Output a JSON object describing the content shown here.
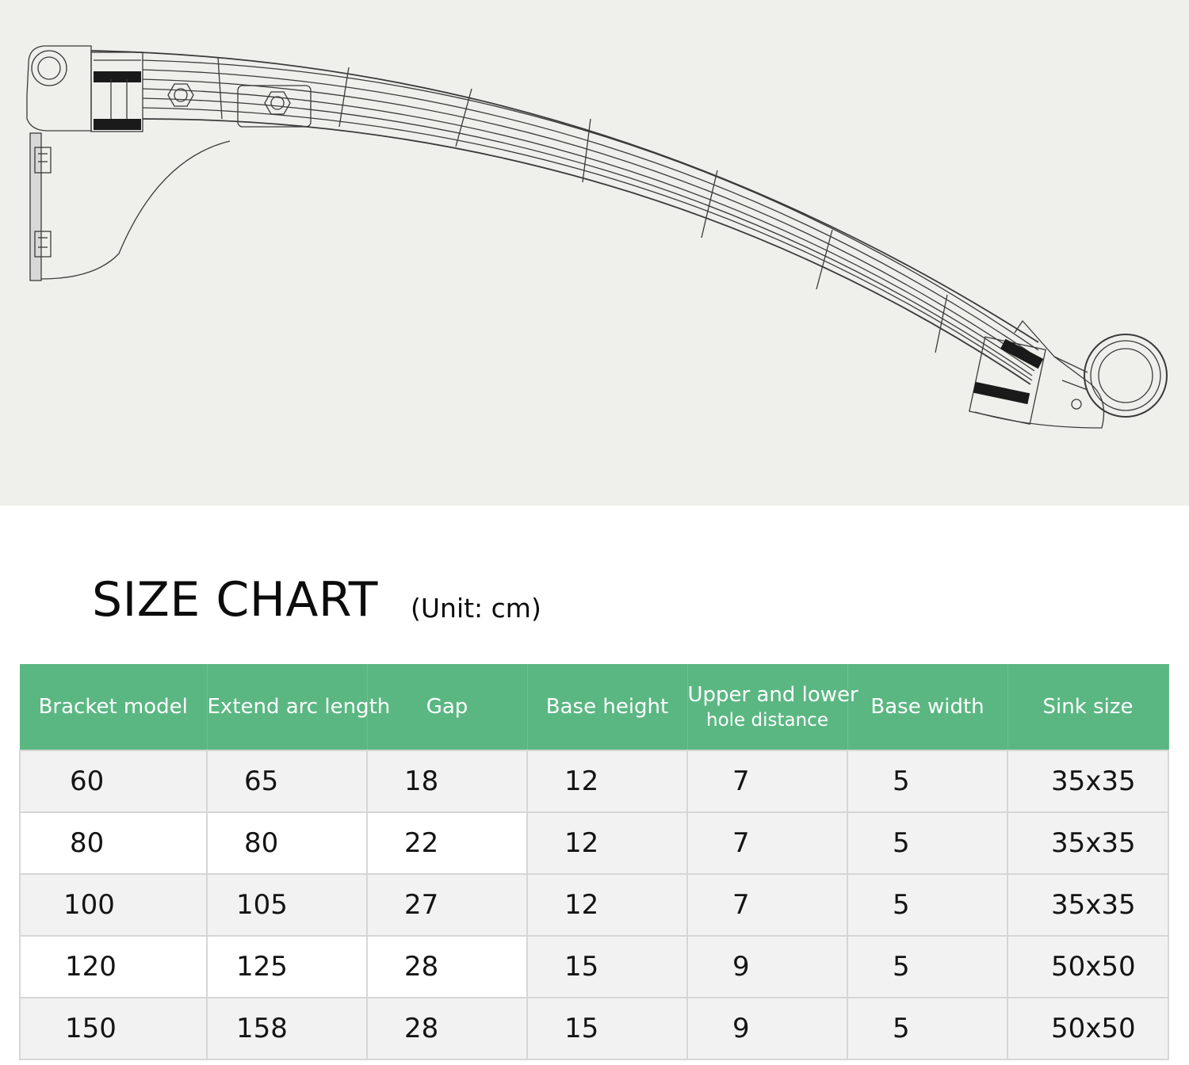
{
  "drawing": {
    "icon": "bracket-technical-drawing"
  },
  "title": "SIZE CHART",
  "unit": "(Unit: cm)",
  "table": {
    "headers": [
      {
        "line1": "Bracket model",
        "line2": ""
      },
      {
        "line1": "Extend arc length",
        "line2": ""
      },
      {
        "line1": "Gap",
        "line2": ""
      },
      {
        "line1": "Base height",
        "line2": ""
      },
      {
        "line1": "Upper and lower",
        "line2": "hole distance"
      },
      {
        "line1": "Base width",
        "line2": ""
      },
      {
        "line1": "Sink size",
        "line2": ""
      }
    ],
    "rows": [
      [
        "60",
        "65",
        "18",
        "12",
        "7",
        "5",
        "35x35"
      ],
      [
        "80",
        "80",
        "22",
        "12",
        "7",
        "5",
        "35x35"
      ],
      [
        "100",
        "105",
        "27",
        "12",
        "7",
        "5",
        "35x35"
      ],
      [
        "120",
        "125",
        "28",
        "15",
        "9",
        "5",
        "50x50"
      ],
      [
        "150",
        "158",
        "28",
        "15",
        "9",
        "5",
        "50x50"
      ]
    ]
  },
  "colors": {
    "header_bg": "#5bb782",
    "header_text": "#ffffff",
    "row_shade": "#f2f2f2",
    "grid": "#d6d6d6"
  }
}
